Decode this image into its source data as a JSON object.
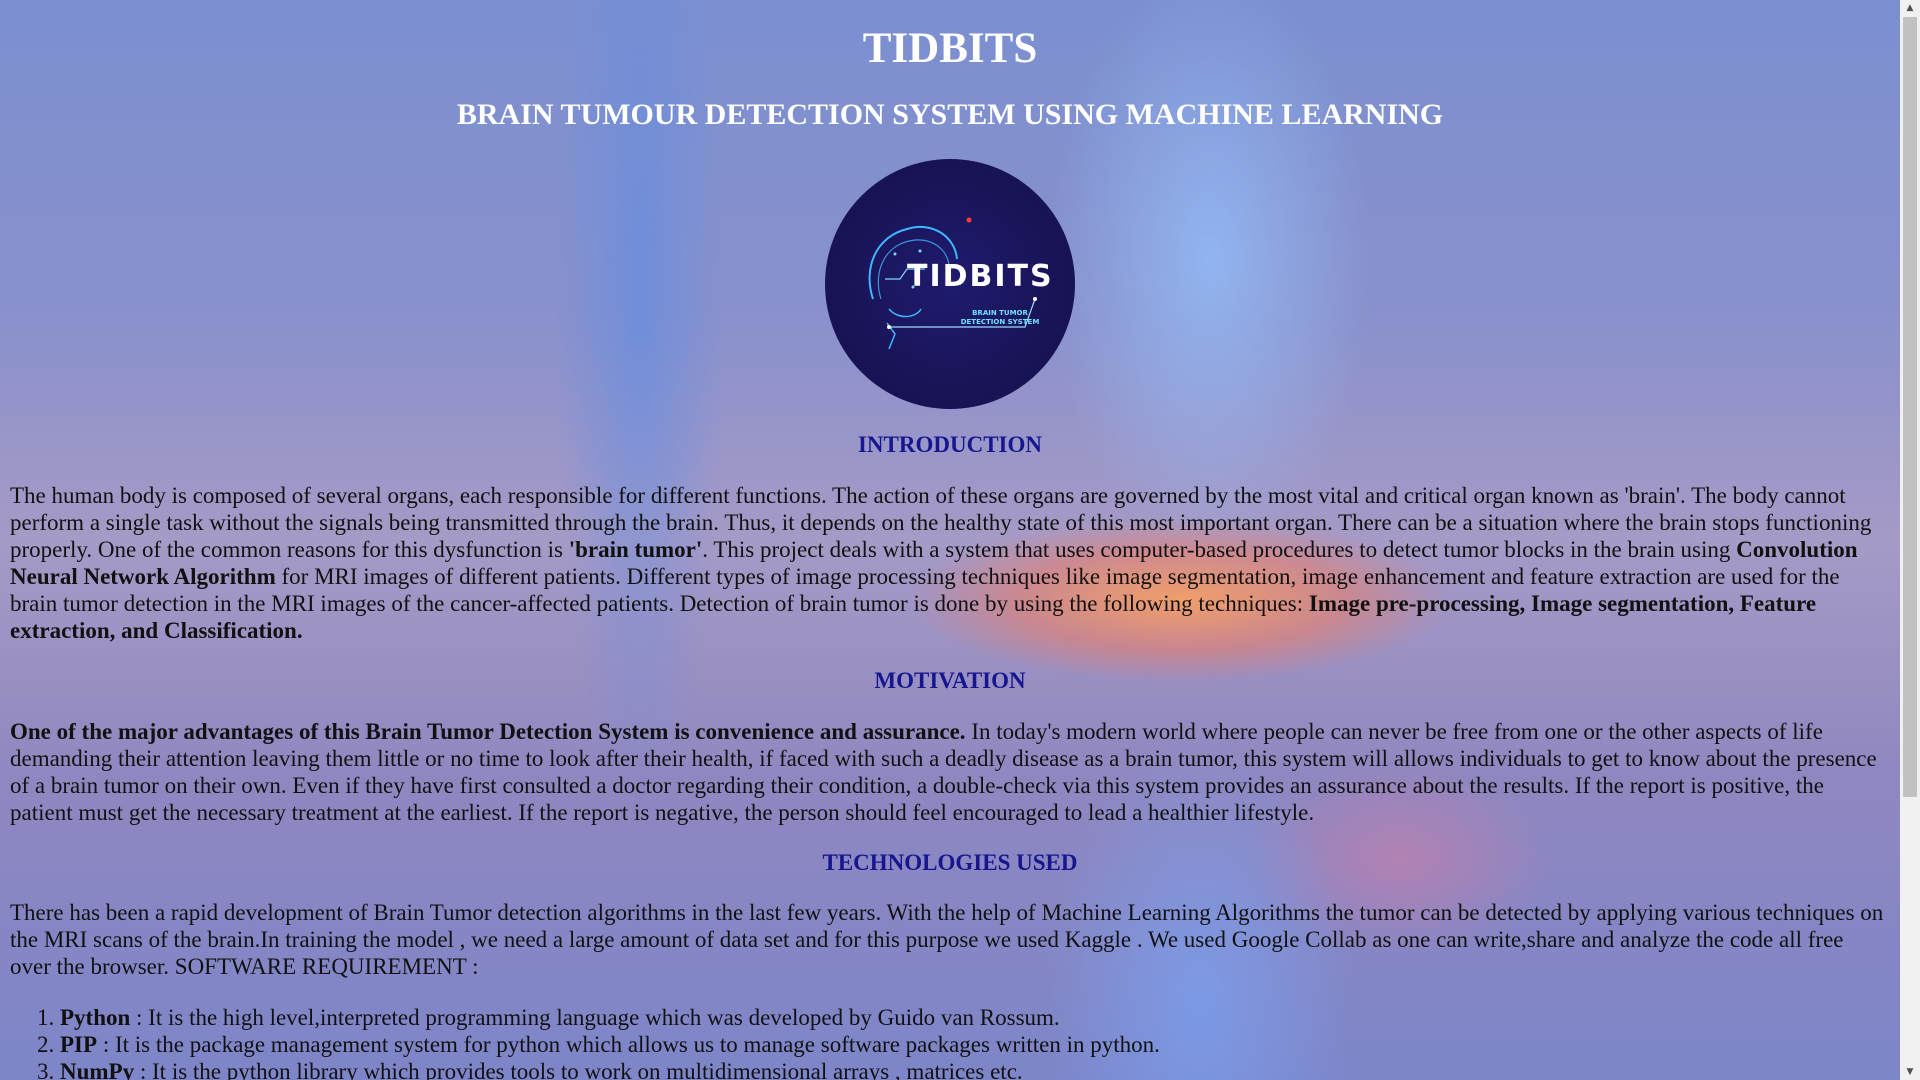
{
  "header": {
    "title": "TIDBITS",
    "subtitle": "BRAIN TUMOUR DETECTION SYSTEM USING MACHINE LEARNING"
  },
  "logo": {
    "text": "TIDBITS",
    "subtext": "BRAIN TUMOR DETECTION SYSTEM",
    "icon": "brain-circuit-icon",
    "bg_color": "#191457"
  },
  "introduction": {
    "heading": "INTRODUCTION",
    "p1": "The human body is composed of several organs, each responsible for different functions. The action of these organs are governed by the most vital and critical organ known as 'brain'. The body cannot perform a single task without the signals being transmitted through the brain. Thus, it depends on the healthy state of this most important organ. There can be a situation where the brain stops functioning properly. One of the common reasons for this dysfunction is ",
    "b1": "'brain tumor'",
    "p2": ". This project deals with a system that uses computer-based procedures to detect tumor blocks in the brain using ",
    "b2": "Convolution Neural Network Algorithm",
    "p3": " for MRI images of different patients. Different types of image processing techniques like image segmentation, image enhancement and feature extraction are used for the brain tumor detection in the MRI images of the cancer-affected patients. Detection of brain tumor is done by using the following techniques: ",
    "b3": "Image pre-processing, Image segmentation, Feature extraction, and Classification."
  },
  "motivation": {
    "heading": "MOTIVATION",
    "b1": "One of the major advantages of this Brain Tumor Detection System is convenience and assurance.",
    "p1": " In today's modern world where people can never be free from one or the other aspects of life demanding their attention leaving them little or no time to look after their health, if faced with such a deadly disease as a brain tumor, this system will allows individuals to get to know about the presence of a brain tumor on their own. Even if they have first consulted a doctor regarding their condition, a double-check via this system provides an assurance about the results. If the report is positive, the patient must get the necessary treatment at the earliest. If the report is negative, the person should feel encouraged to lead a healthier lifestyle."
  },
  "technologies": {
    "heading": "TECHNOLOGIES USED",
    "text": "There has been a rapid development of Brain Tumor detection algorithms in the last few years. With the help of Machine Learning Algorithms the tumor can be detected by applying various techniques on the MRI scans of the brain.In training the model , we need a large amount of data set and for this purpose we used Kaggle . We used Google Collab as one can write,share and analyze the code all free over the browser. SOFTWARE REQUIREMENT :",
    "items": [
      {
        "name": "Python",
        "desc": " : It is the high level,interpreted programming language which was developed by Guido van Rossum."
      },
      {
        "name": "PIP",
        "desc": " : It is the package management system for python which allows us to manage software packages written in python."
      },
      {
        "name": "NumPy",
        "desc": " : It is the python library which provides tools to work on multidimensional arrays , matrices etc."
      }
    ]
  },
  "scrollbar": {
    "up_icon": "scroll-up-arrow-icon",
    "down_icon": "scroll-down-arrow-icon",
    "position": 0.0
  },
  "colors": {
    "heading": "#16168f",
    "title": "#ffffff"
  }
}
